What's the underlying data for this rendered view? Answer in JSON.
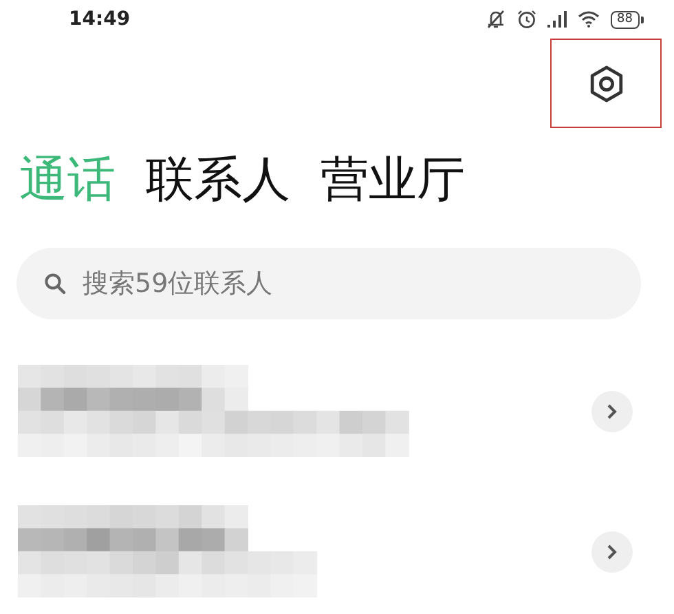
{
  "status_bar": {
    "time": "14:49",
    "battery": "88"
  },
  "settings_button": {
    "highlighted": true
  },
  "tabs": [
    {
      "label": "通话",
      "selected": true
    },
    {
      "label": "联系人",
      "selected": false
    },
    {
      "label": "营业厅",
      "selected": false
    }
  ],
  "search": {
    "placeholder": "搜索59位联系人"
  },
  "rows": [
    {
      "kind": "redacted",
      "chevron": true
    },
    {
      "kind": "redacted",
      "chevron": true
    }
  ]
}
